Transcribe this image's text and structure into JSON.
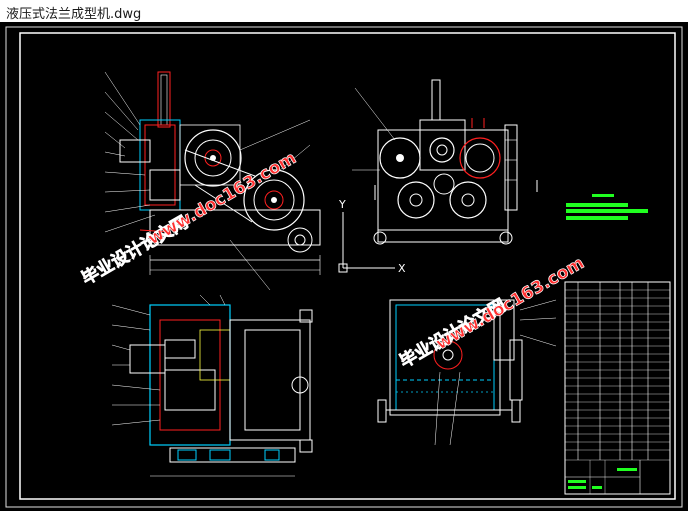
{
  "window": {
    "title": "液压式法兰成型机.dwg"
  },
  "drawing": {
    "watermark_1": "毕业设计论文网",
    "watermark_2": "www.doc163.com",
    "axis_y": "Y",
    "axis_x": "X"
  },
  "colors": {
    "background": "#000000",
    "frame": "#ffffff",
    "red": "#ff2020",
    "cyan": "#00d0ff",
    "green": "#20ff20",
    "yellow": "#ffff40",
    "magenta": "#ff40ff"
  }
}
